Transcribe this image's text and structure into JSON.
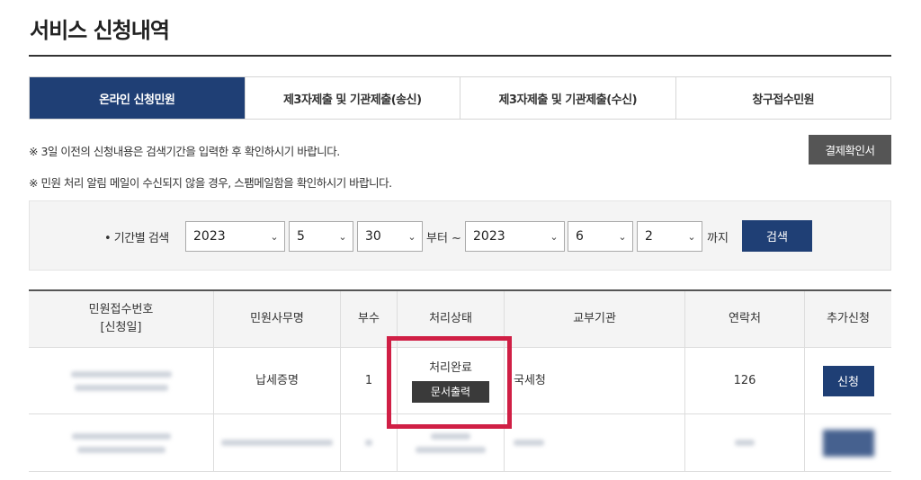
{
  "page_title": "서비스 신청내역",
  "tabs": [
    {
      "label": "온라인 신청민원",
      "active": true
    },
    {
      "label": "제3자제출 및 기관제출(송신)",
      "active": false
    },
    {
      "label": "제3자제출 및 기관제출(수신)",
      "active": false
    },
    {
      "label": "창구접수민원",
      "active": false
    }
  ],
  "notices": [
    "※ 3일 이전의 신청내용은 검색기간을 입력한 후 확인하시기 바랍니다.",
    "※ 민원 처리 알림 메일이 수신되지 않을 경우, 스팸메일함을 확인하시기 바랍니다."
  ],
  "receipt_button": "결제확인서",
  "search": {
    "label": "• 기간별 검색",
    "from_year": "2023",
    "from_month": "5",
    "from_day": "30",
    "from_suffix": "부터 ~",
    "to_year": "2023",
    "to_month": "6",
    "to_day": "2",
    "to_suffix": "까지",
    "button": "검색"
  },
  "table": {
    "headers": {
      "receipt_no_line1": "민원접수번호",
      "receipt_no_line2": "[신청일]",
      "task_name": "민원사무명",
      "copies": "부수",
      "status": "처리상태",
      "agency": "교부기관",
      "contact": "연락처",
      "extra": "추가신청"
    },
    "rows": [
      {
        "task_name": "납세증명",
        "copies": "1",
        "status": "처리완료",
        "print_button": "문서출력",
        "agency": "국세청",
        "contact": "126",
        "apply_button": "신청"
      }
    ]
  },
  "colors": {
    "primary": "#1f3f75",
    "highlight": "#d01f45",
    "dark_button": "#3a3a3a"
  }
}
